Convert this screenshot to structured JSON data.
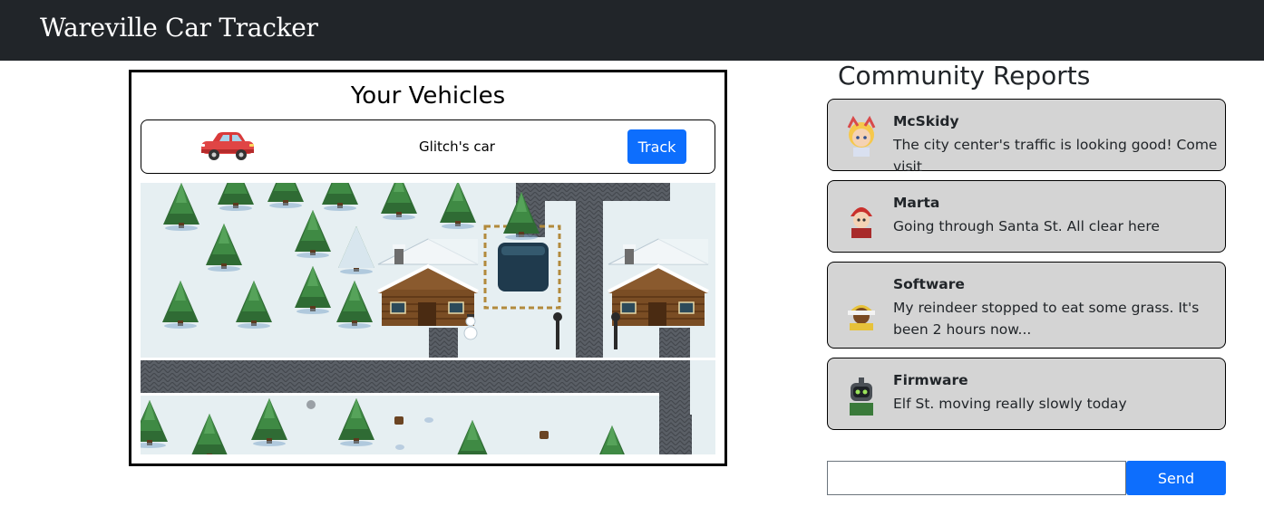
{
  "navbar": {
    "brand": "Wareville Car Tracker"
  },
  "vehicles": {
    "title": "Your Vehicles",
    "items": [
      {
        "name": "Glitch's car",
        "icon": "red-car-icon",
        "track_label": "Track"
      }
    ]
  },
  "map": {
    "description_icon": "snowy-town-map-icon"
  },
  "community": {
    "title": "Community Reports",
    "reports": [
      {
        "user": "McSkidy",
        "text": "The city center's traffic is looking good! Come visit",
        "avatar": "mcskidy-avatar-icon"
      },
      {
        "user": "Marta",
        "text": "Going through Santa St. All clear here",
        "avatar": "marta-avatar-icon"
      },
      {
        "user": "Software",
        "text": "My reindeer stopped to eat some grass. It's been 2 hours now...",
        "avatar": "software-avatar-icon"
      },
      {
        "user": "Firmware",
        "text": "Elf St. moving really slowly today",
        "avatar": "firmware-avatar-icon"
      }
    ]
  },
  "composer": {
    "value": "",
    "placeholder": "",
    "send_label": "Send"
  },
  "colors": {
    "navbar": "#212529",
    "primary": "#0d6efd",
    "report_bg": "#d4d4d4",
    "snow": "#e6eff2",
    "road": "#555a60",
    "tree": "#2f6b34"
  }
}
